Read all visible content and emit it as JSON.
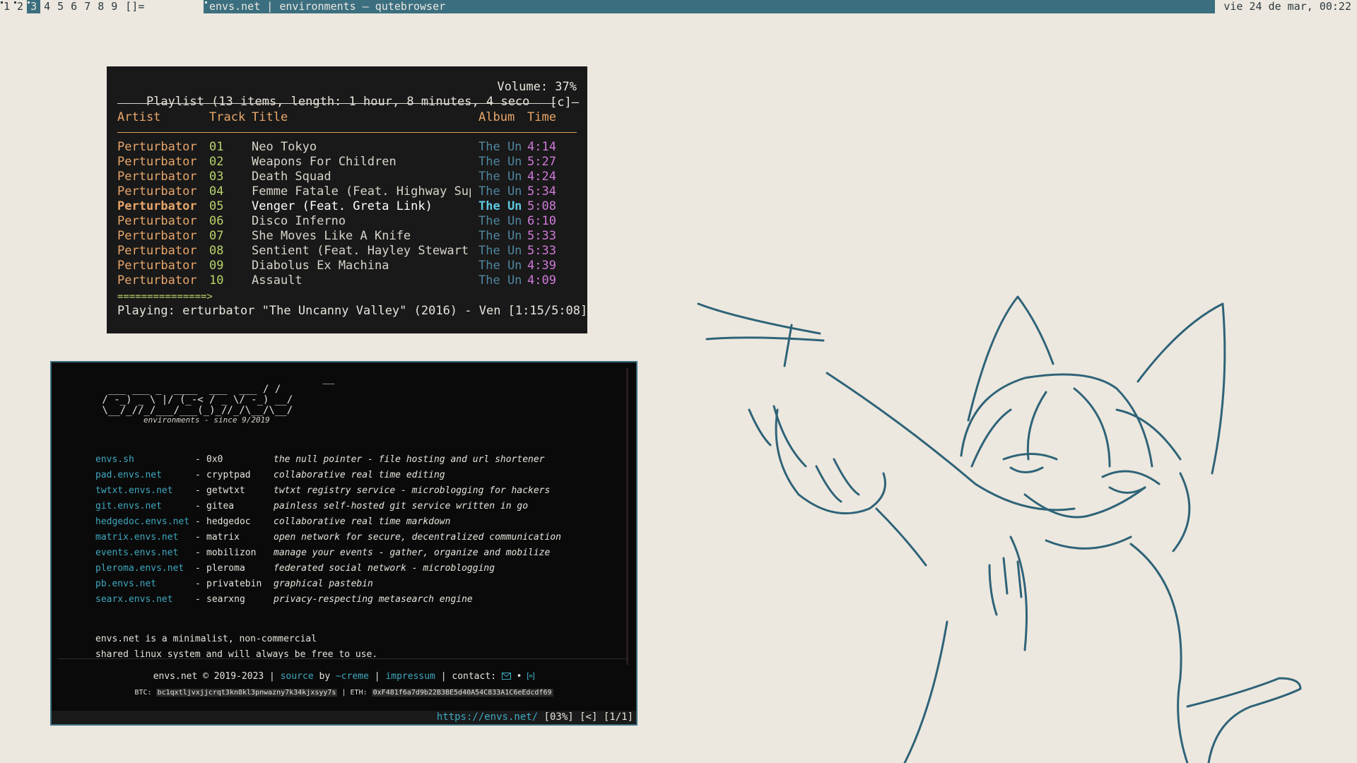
{
  "topbar": {
    "workspaces": [
      "1",
      "2",
      "3",
      "4",
      "5",
      "6",
      "7",
      "8",
      "9"
    ],
    "active_workspace": "3",
    "layout": "[]=",
    "window_title": "envs.net | environments — qutebrowser",
    "clock": "vie 24 de mar, 00:22"
  },
  "cmus": {
    "header": "Playlist (13 items, length: 1 hour, 8 minutes, 4 seco",
    "volume": "Volume: 37%",
    "corner": "[c]—",
    "columns": {
      "artist": "Artist",
      "track": "Track",
      "title": "Title",
      "album": "Album",
      "time": "Time"
    },
    "rows": [
      {
        "artist": "Perturbator",
        "track": "01",
        "title": "Neo Tokyo",
        "album": "The Un",
        "time": "4:14"
      },
      {
        "artist": "Perturbator",
        "track": "02",
        "title": "Weapons For Children",
        "album": "The Un",
        "time": "5:27"
      },
      {
        "artist": "Perturbator",
        "track": "03",
        "title": "Death Squad",
        "album": "The Un",
        "time": "4:24"
      },
      {
        "artist": "Perturbator",
        "track": "04",
        "title": "Femme Fatale (Feat. Highway Sup",
        "album": "The Un",
        "time": "5:34"
      },
      {
        "artist": "Perturbator",
        "track": "05",
        "title": "Venger (Feat. Greta Link)",
        "album": "The Un",
        "time": "5:08"
      },
      {
        "artist": "Perturbator",
        "track": "06",
        "title": "Disco Inferno",
        "album": "The Un",
        "time": "6:10"
      },
      {
        "artist": "Perturbator",
        "track": "07",
        "title": "She Moves Like A Knife",
        "album": "The Un",
        "time": "5:33"
      },
      {
        "artist": "Perturbator",
        "track": "08",
        "title": "Sentient (Feat. Hayley Stewart)",
        "album": "The Un",
        "time": "5:33"
      },
      {
        "artist": "Perturbator",
        "track": "09",
        "title": "Diabolus Ex Machina",
        "album": "The Un",
        "time": "4:39"
      },
      {
        "artist": "Perturbator",
        "track": "10",
        "title": "Assault",
        "album": "The Un",
        "time": "4:09"
      }
    ],
    "current_index": 4,
    "progress_bar": "===============>",
    "playing": "Playing: erturbator \"The Uncanny Valley\" (2016) - Ven [1:15/5:08]"
  },
  "browser": {
    "logo_ascii": "                                      __\n  ___ ___ _  ____  ___  ___ / /\n / -_) _ \\ |/ (_-< / _ \\/ -_) __/\n \\__/_//_/___/___(_)_//_/\\__/\\__/",
    "subtitle": "environments - since 9/2019",
    "services": [
      {
        "host": "envs.sh",
        "name": "0x0",
        "desc": "the null pointer - file hosting and url shortener"
      },
      {
        "host": "pad.envs.net",
        "name": "cryptpad",
        "desc": "collaborative real time editing"
      },
      {
        "host": "twtxt.envs.net",
        "name": "getwtxt",
        "desc": "twtxt registry service - microblogging for hackers"
      },
      {
        "host": "git.envs.net",
        "name": "gitea",
        "desc": "painless self-hosted git service written in go"
      },
      {
        "host": "hedgedoc.envs.net",
        "name": "hedgedoc",
        "desc": "collaborative real time markdown"
      },
      {
        "host": "matrix.envs.net",
        "name": "matrix",
        "desc": "open network for secure, decentralized communication"
      },
      {
        "host": "events.envs.net",
        "name": "mobilizon",
        "desc": "manage your events - gather, organize and mobilize"
      },
      {
        "host": "pleroma.envs.net",
        "name": "pleroma",
        "desc": "federated social network - microblogging"
      },
      {
        "host": "pb.envs.net",
        "name": "privatebin",
        "desc": "graphical pastebin"
      },
      {
        "host": "searx.envs.net",
        "name": "searxng",
        "desc": "privacy-respecting metasearch engine"
      }
    ],
    "description_1": "envs.net is a minimalist, non-commercial",
    "description_2": "shared linux system and will always be free to use.",
    "footer": {
      "copyright": "envs.net © 2019-2023 | ",
      "source": "source",
      "by": " by ",
      "author": "~creme",
      "sep": " | ",
      "impressum": "impressum",
      "contact": " | contact: ",
      "dot": " • ",
      "btc_label": "BTC: ",
      "btc": "bc1qxtljvxjjcrqt3kn8kl3pnwazny7k34kjxsyy7s",
      "eth_label": " | ETH: ",
      "eth": "0xF481f6a7d9b22B3BE5d40A54C833A1C6eEdcdf69"
    },
    "status": {
      "url": "https://envs.net/",
      "scroll": " [03%]",
      "hist": " [<]",
      "tabs": " [1/1]"
    }
  },
  "colors": {
    "bar_accent": "#3b6f80",
    "desktop_bg": "#ece8df",
    "sketch_stroke": "#2f6378"
  }
}
